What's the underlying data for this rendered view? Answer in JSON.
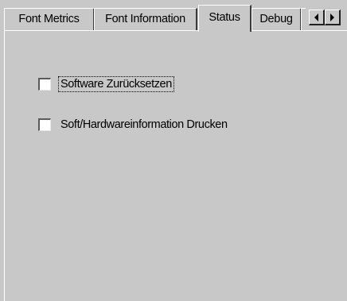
{
  "tabs": [
    {
      "label": "Font Metrics",
      "active": false
    },
    {
      "label": "Font Information",
      "active": false
    },
    {
      "label": "Status",
      "active": true
    },
    {
      "label": "Debug",
      "active": false
    }
  ],
  "scroll_buttons": {
    "left_icon": "arrow-left-icon",
    "right_icon": "arrow-right-icon"
  },
  "status_page": {
    "options": [
      {
        "label": "Software Zurücksetzen",
        "checked": false,
        "focused": true
      },
      {
        "label": "Soft/Hardwareinformation Drucken",
        "checked": false,
        "focused": false
      }
    ]
  },
  "colors": {
    "background": "#c8c8c8",
    "highlight": "#ffffff",
    "shadow": "#3a3a3a"
  }
}
